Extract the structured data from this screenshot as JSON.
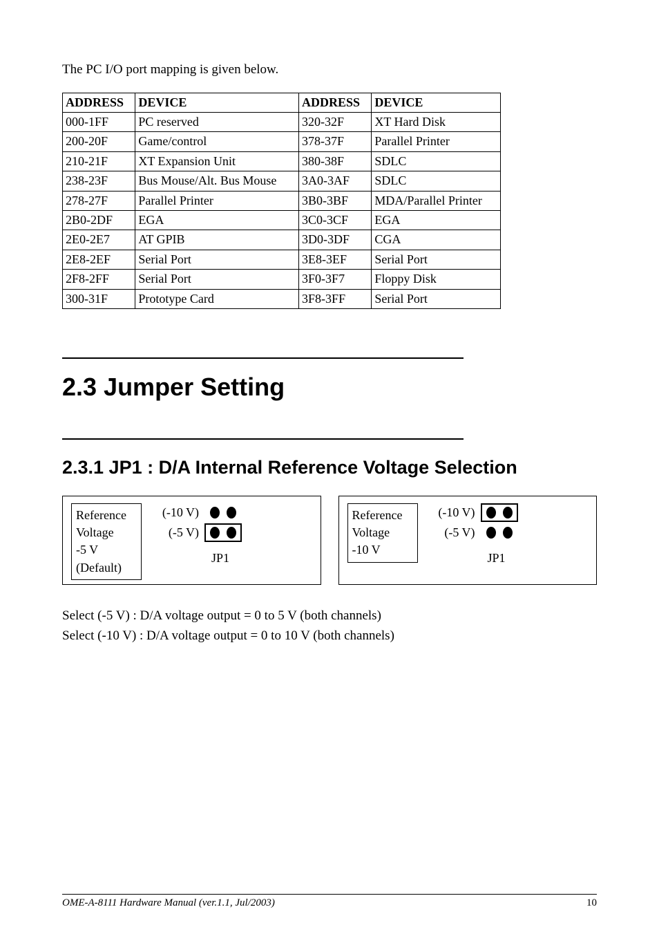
{
  "intro": "The PC I/O port mapping is given below.",
  "headers": {
    "addr": "ADDRESS",
    "dev": "DEVICE"
  },
  "rows": [
    {
      "a1": "000-1FF",
      "d1": "PC reserved",
      "a2": "320-32F",
      "d2": "XT Hard Disk"
    },
    {
      "a1": "200-20F",
      "d1": "Game/control",
      "a2": "378-37F",
      "d2": "Parallel Printer"
    },
    {
      "a1": "210-21F",
      "d1": "XT Expansion Unit",
      "a2": "380-38F",
      "d2": "SDLC"
    },
    {
      "a1": "238-23F",
      "d1": "Bus Mouse/Alt. Bus Mouse",
      "a2": "3A0-3AF",
      "d2": "SDLC"
    },
    {
      "a1": "278-27F",
      "d1": "Parallel Printer",
      "a2": "3B0-3BF",
      "d2": "MDA/Parallel Printer"
    },
    {
      "a1": "2B0-2DF",
      "d1": "EGA",
      "a2": "3C0-3CF",
      "d2": "EGA"
    },
    {
      "a1": "2E0-2E7",
      "d1": "AT GPIB",
      "a2": "3D0-3DF",
      "d2": "CGA"
    },
    {
      "a1": "2E8-2EF",
      "d1": "Serial Port",
      "a2": "3E8-3EF",
      "d2": "Serial Port"
    },
    {
      "a1": "2F8-2FF",
      "d1": "Serial Port",
      "a2": "3F0-3F7",
      "d2": "Floppy Disk"
    },
    {
      "a1": "300-31F",
      "d1": "Prototype Card",
      "a2": "3F8-3FF",
      "d2": "Serial Port"
    }
  ],
  "section_title": "2.3   Jumper Setting",
  "subsection_title": "2.3.1   JP1 : D/A Internal Reference Voltage Selection",
  "box1": {
    "l1": "Reference",
    "l2": "Voltage",
    "l3": "-5 V",
    "l4": "(Default)"
  },
  "box2": {
    "l1": "Reference",
    "l2": "Voltage",
    "l3": "-10 V"
  },
  "opt10": "(-10 V)",
  "opt5": "(-5 V)",
  "jp": "JP1",
  "note1": "Select (-5 V)   : D/A voltage output = 0 to 5 V (both channels)",
  "note2": "Select (-10 V) : D/A voltage output = 0 to 10 V (both channels)",
  "footer": "OME-A-8111 Hardware Manual (ver.1.1, Jul/2003)",
  "page": "10"
}
